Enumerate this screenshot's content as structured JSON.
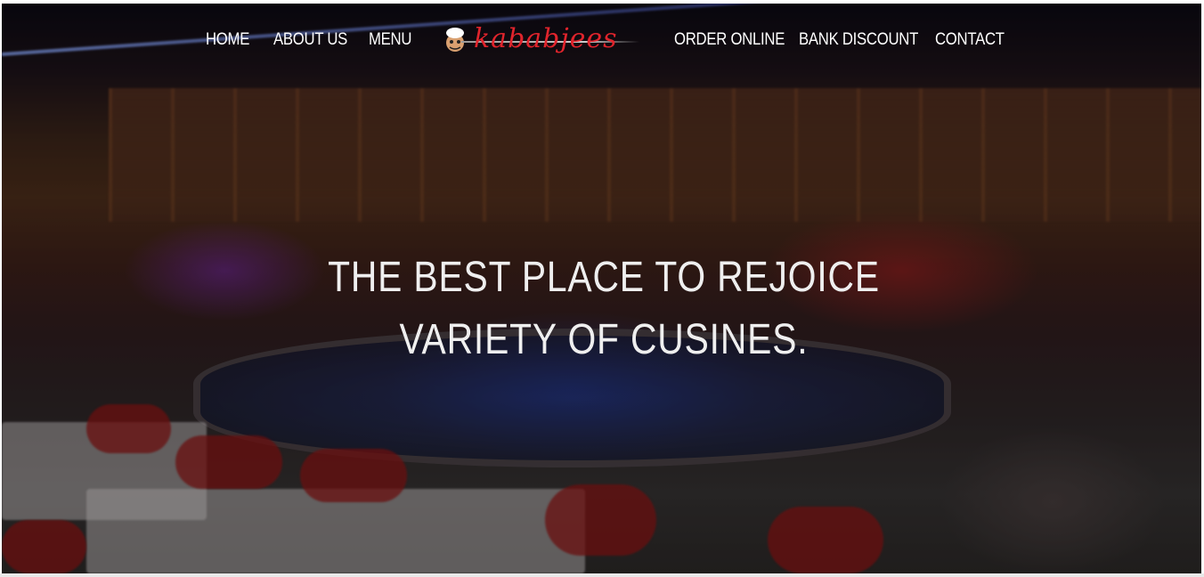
{
  "nav": {
    "left": [
      "HOME",
      "ABOUT US",
      "MENU"
    ],
    "right": [
      "ORDER ONLINE",
      "BANK DISCOUNT",
      "CONTACT"
    ]
  },
  "logo": {
    "text": "kababjees",
    "icon": "chef-mascot-icon",
    "color": "#e0242c"
  },
  "hero": {
    "line1": "THE BEST PLACE TO REJOICE",
    "line2": "VARIETY OF CUSINES."
  }
}
